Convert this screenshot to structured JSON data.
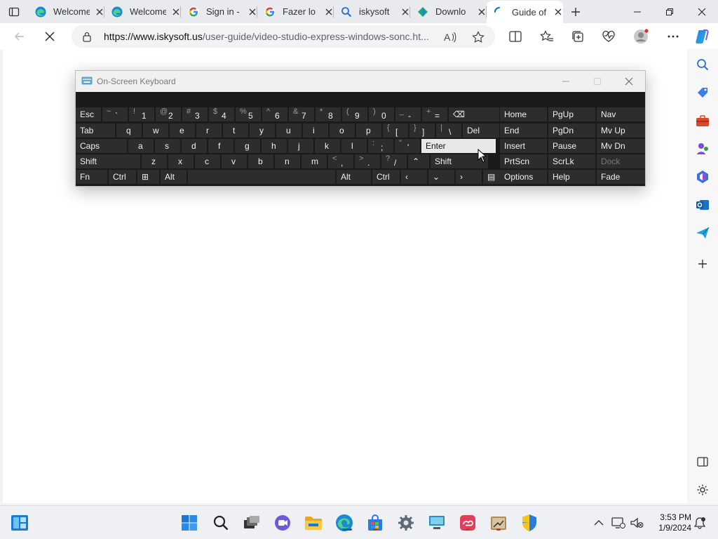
{
  "browser": {
    "tabs": [
      {
        "title": "Welcome",
        "icon": "edge-icon",
        "active": false
      },
      {
        "title": "Welcome",
        "icon": "edge-icon",
        "active": false
      },
      {
        "title": "Sign in -",
        "icon": "google-icon",
        "active": false
      },
      {
        "title": "Fazer lo",
        "icon": "google-icon",
        "active": false
      },
      {
        "title": "iskysoft",
        "icon": "search-icon",
        "active": false
      },
      {
        "title": "Downlo",
        "icon": "iskysoft-icon",
        "active": false
      },
      {
        "title": "Guide of",
        "icon": "loading-icon",
        "active": true
      }
    ],
    "url_host": "https://www.iskysoft.us",
    "url_path": "/user-guide/video-studio-express-windows-sonc.ht..."
  },
  "osk": {
    "title": "On-Screen Keyboard",
    "rows": [
      [
        {
          "main": "Esc"
        },
        {
          "shift": "~",
          "primary": "`"
        },
        {
          "shift": "!",
          "primary": "1"
        },
        {
          "shift": "@",
          "primary": "2"
        },
        {
          "shift": "#",
          "primary": "3"
        },
        {
          "shift": "$",
          "primary": "4"
        },
        {
          "shift": "%",
          "primary": "5"
        },
        {
          "shift": "^",
          "primary": "6"
        },
        {
          "shift": "&",
          "primary": "7"
        },
        {
          "shift": "*",
          "primary": "8"
        },
        {
          "shift": "(",
          "primary": "9"
        },
        {
          "shift": ")",
          "primary": "0"
        },
        {
          "shift": "_",
          "primary": "-"
        },
        {
          "shift": "+",
          "primary": "="
        },
        {
          "main": "⌫"
        }
      ],
      [
        {
          "main": "Tab"
        },
        {
          "main": "q"
        },
        {
          "main": "w"
        },
        {
          "main": "e"
        },
        {
          "main": "r"
        },
        {
          "main": "t"
        },
        {
          "main": "y"
        },
        {
          "main": "u"
        },
        {
          "main": "i"
        },
        {
          "main": "o"
        },
        {
          "main": "p"
        },
        {
          "shift": "{",
          "primary": "["
        },
        {
          "shift": "}",
          "primary": "]"
        },
        {
          "shift": "|",
          "primary": "\\"
        },
        {
          "main": "Del"
        }
      ],
      [
        {
          "main": "Caps"
        },
        {
          "main": "a"
        },
        {
          "main": "s"
        },
        {
          "main": "d"
        },
        {
          "main": "f"
        },
        {
          "main": "g"
        },
        {
          "main": "h"
        },
        {
          "main": "j"
        },
        {
          "main": "k"
        },
        {
          "main": "l"
        },
        {
          "shift": ":",
          "primary": ";"
        },
        {
          "shift": "\"",
          "primary": "'"
        },
        {
          "main": "Enter"
        }
      ],
      [
        {
          "main": "Shift"
        },
        {
          "main": "z"
        },
        {
          "main": "x"
        },
        {
          "main": "c"
        },
        {
          "main": "v"
        },
        {
          "main": "b"
        },
        {
          "main": "n"
        },
        {
          "main": "m"
        },
        {
          "shift": "<",
          "primary": ","
        },
        {
          "shift": ">",
          "primary": "."
        },
        {
          "shift": "?",
          "primary": "/"
        },
        {
          "main": "⌃"
        },
        {
          "main": "Shift"
        }
      ],
      [
        {
          "main": "Fn"
        },
        {
          "main": "Ctrl"
        },
        {
          "main": "⊞"
        },
        {
          "main": "Alt"
        },
        {
          "main": ""
        },
        {
          "main": "Alt"
        },
        {
          "main": "Ctrl"
        },
        {
          "main": "‹"
        },
        {
          "main": "⌄"
        },
        {
          "main": "›"
        },
        {
          "main": "▤"
        }
      ]
    ],
    "nav_keys": [
      [
        "Home",
        "PgUp",
        "Nav"
      ],
      [
        "End",
        "PgDn",
        "Mv Up"
      ],
      [
        "Insert",
        "Pause",
        "Mv Dn"
      ],
      [
        "PrtScn",
        "ScrLk",
        "Dock"
      ],
      [
        "Options",
        "Help",
        "Fade"
      ]
    ]
  },
  "taskbar": {
    "time": "3:53 PM",
    "date": "1/9/2024"
  },
  "colors": {
    "osk_bg": "#1b1b1b",
    "key_bg": "#2d2d2d",
    "key_hot": "#e8e8e8",
    "taskbar_bg": "#eef0f4",
    "accent": "#0078d4"
  }
}
